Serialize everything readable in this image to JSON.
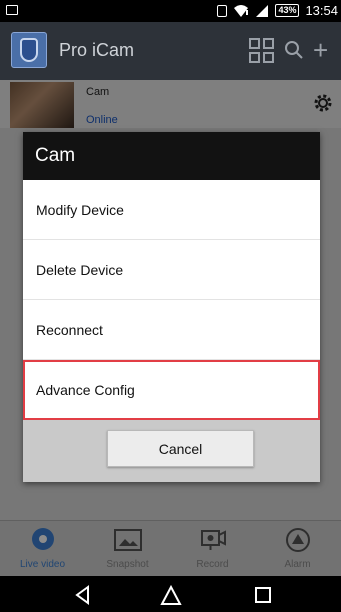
{
  "status_bar": {
    "battery": "43%",
    "time": "13:54"
  },
  "app_bar": {
    "title": "Pro iCam"
  },
  "device": {
    "name": "Cam",
    "status": "Online"
  },
  "dialog": {
    "title": "Cam",
    "items": [
      {
        "label": "Modify Device"
      },
      {
        "label": "Delete Device"
      },
      {
        "label": "Reconnect"
      },
      {
        "label": "Advance Config"
      }
    ],
    "cancel_label": "Cancel"
  },
  "tabs": [
    {
      "label": "Live video",
      "icon": "live-video-icon",
      "active": true
    },
    {
      "label": "Snapshot",
      "icon": "snapshot-icon",
      "active": false
    },
    {
      "label": "Record",
      "icon": "record-icon",
      "active": false
    },
    {
      "label": "Alarm",
      "icon": "alarm-icon",
      "active": false
    }
  ],
  "colors": {
    "accent": "#3c7fd1",
    "highlight_border": "#e23d45",
    "app_bar_bg": "#2d3239",
    "dialog_title_bg": "#121212"
  }
}
